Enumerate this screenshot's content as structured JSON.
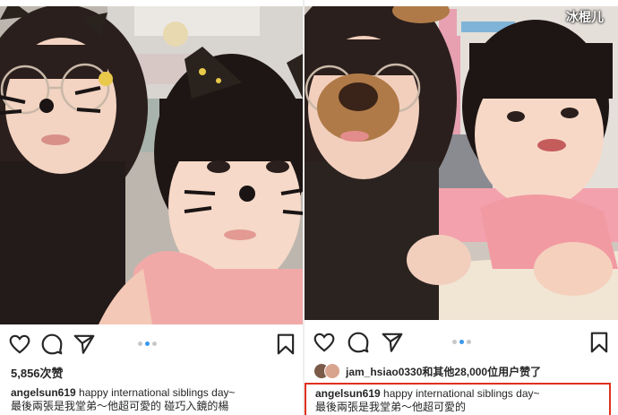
{
  "watermark": "冰棍儿",
  "posts": [
    {
      "carousel_count": 3,
      "carousel_active": 1,
      "likes": "5,856次赞",
      "caption_user": "angelsun619",
      "caption_line1": "happy international siblings day~",
      "caption_line2": "最後兩張是我堂弟～他超可愛的 碰巧入鏡的楊"
    },
    {
      "carousel_count": 3,
      "carousel_active": 1,
      "liked_by": "jam_hsiao0330和其他28,000位用户赞了",
      "caption_user": "angelsun619",
      "caption_line1": "happy international siblings day~",
      "caption_line2": "最後兩張是我堂弟～他超可愛的"
    }
  ],
  "icons": [
    "heart-icon",
    "comment-icon",
    "share-icon",
    "bookmark-icon"
  ],
  "colors": {
    "accent_dot": "#3897f0",
    "highlight_border": "#e0301e",
    "text": "#262626"
  }
}
